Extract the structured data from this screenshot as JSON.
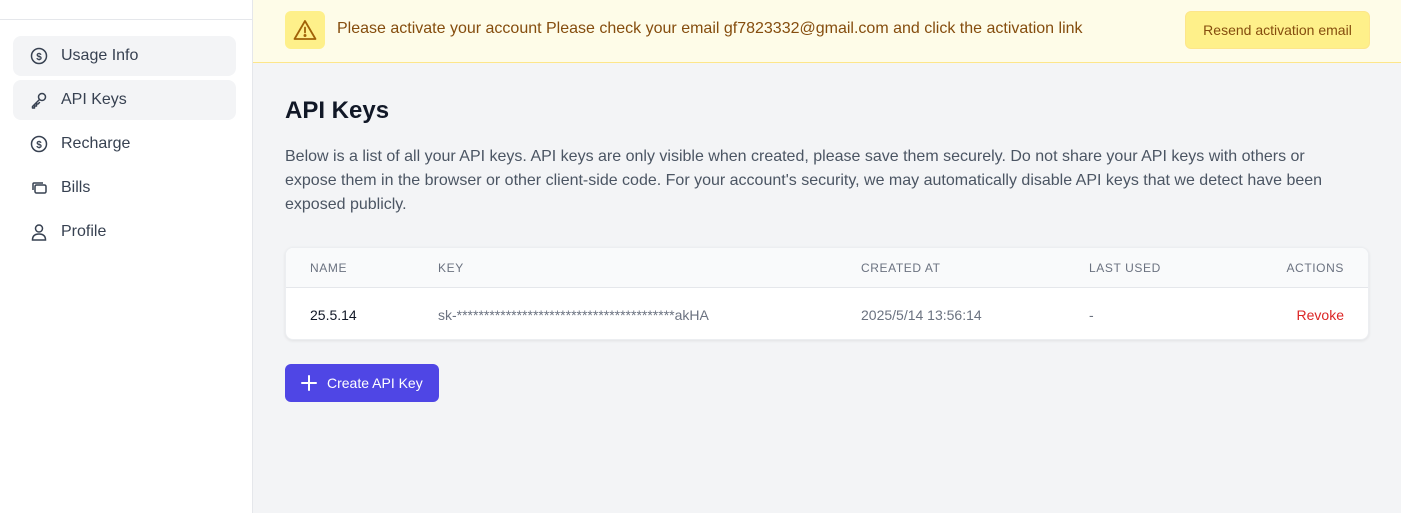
{
  "sidebar": {
    "items": [
      {
        "label": "Usage Info",
        "icon": "dollar-circle-icon",
        "active": true
      },
      {
        "label": "API Keys",
        "icon": "key-icon",
        "active": true
      },
      {
        "label": "Recharge",
        "icon": "dollar-circle-icon",
        "active": false
      },
      {
        "label": "Bills",
        "icon": "cards-icon",
        "active": false
      },
      {
        "label": "Profile",
        "icon": "user-icon",
        "active": false
      }
    ]
  },
  "banner": {
    "icon": "warning-icon",
    "message": "Please activate your account Please check your email gf7823332@gmail.com and click the activation link",
    "resend_label": "Resend activation email"
  },
  "main": {
    "title": "API Keys",
    "description": "Below is a list of all your API keys. API keys are only visible when created, please save them securely. Do not share your API keys with others or expose them in the browser or other client-side code. For your account's security, we may automatically disable API keys that we detect have been exposed publicly.",
    "create_label": "Create API Key"
  },
  "table": {
    "headers": {
      "name": "NAME",
      "key": "KEY",
      "created": "CREATED AT",
      "last_used": "LAST USED",
      "actions": "ACTIONS"
    },
    "rows": [
      {
        "name": "25.5.14",
        "key": "sk-****************************************akHA",
        "created": "2025/5/14 13:56:14",
        "last_used": "-",
        "action": "Revoke"
      }
    ]
  },
  "colors": {
    "accent": "#4f46e5",
    "warning_bg": "#fefce8",
    "danger": "#dc2626"
  }
}
